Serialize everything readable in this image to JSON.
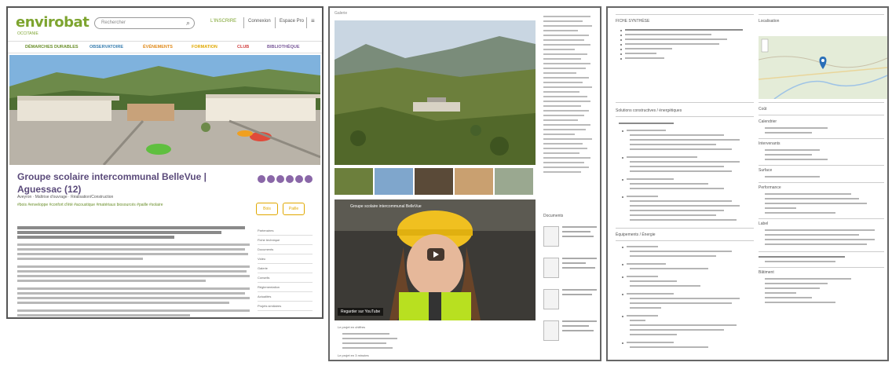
{
  "panel1": {
    "logo": "envirobat",
    "logo_sub": "OCCITANIE",
    "search_placeholder": "Rechercher",
    "top_nav": [
      "L'INSCRIRE",
      "Connexion",
      "Espace Pro"
    ],
    "menu": [
      {
        "label": "Démarches durables",
        "color": "#6a8f2a"
      },
      {
        "label": "Observatoire",
        "color": "#3a7fb0"
      },
      {
        "label": "Événements",
        "color": "#e08a1a"
      },
      {
        "label": "Formation",
        "color": "#e0a800"
      },
      {
        "label": "Club",
        "color": "#d04040"
      },
      {
        "label": "Bibliothèque",
        "color": "#7a5a9a"
      }
    ],
    "title": "Groupe scolaire intercommunal BelleVue | Aguessac (12)",
    "meta_line1": "Aveyron  ·  Maîtrise d'ouvrage  ·  Réalisation/Construction",
    "meta_tags": "#bois  #enveloppe  #confort d'été  #acoustique  #matériaux biosourcés  #paille  #solaire",
    "badges": [
      "Bois",
      "Paille"
    ],
    "side_links": [
      "Partenaires",
      "Fiche technique",
      "Documents",
      "Vidéo",
      "Galerie",
      "Conseils",
      "Réglementation",
      "Actualités",
      "Projets similaires"
    ]
  },
  "panel2": {
    "label": "Galerie",
    "video_title": "Groupe scolaire intercommunal BelleVue",
    "video_watch": "Regarder sur YouTube",
    "side_header": "Documents",
    "bottom_lines": [
      "Le projet en chiffres",
      "Le projet en 3 minutes"
    ]
  },
  "panel3": {
    "col_left_header": "FICHE SYNTHÈSE",
    "col_right_header": "Localisation",
    "section1": "Solutions constructives / énergétiques",
    "section2": "Équipements / Énergie",
    "right_sections": [
      "Coût",
      "Calendrier",
      "Intervenants",
      "Surface",
      "Performance",
      "Label",
      "Bâtiment"
    ]
  },
  "colors": {
    "brand_green": "#7da42f",
    "title_purple": "#5a4a7a",
    "badge_gold": "#e0a800"
  }
}
